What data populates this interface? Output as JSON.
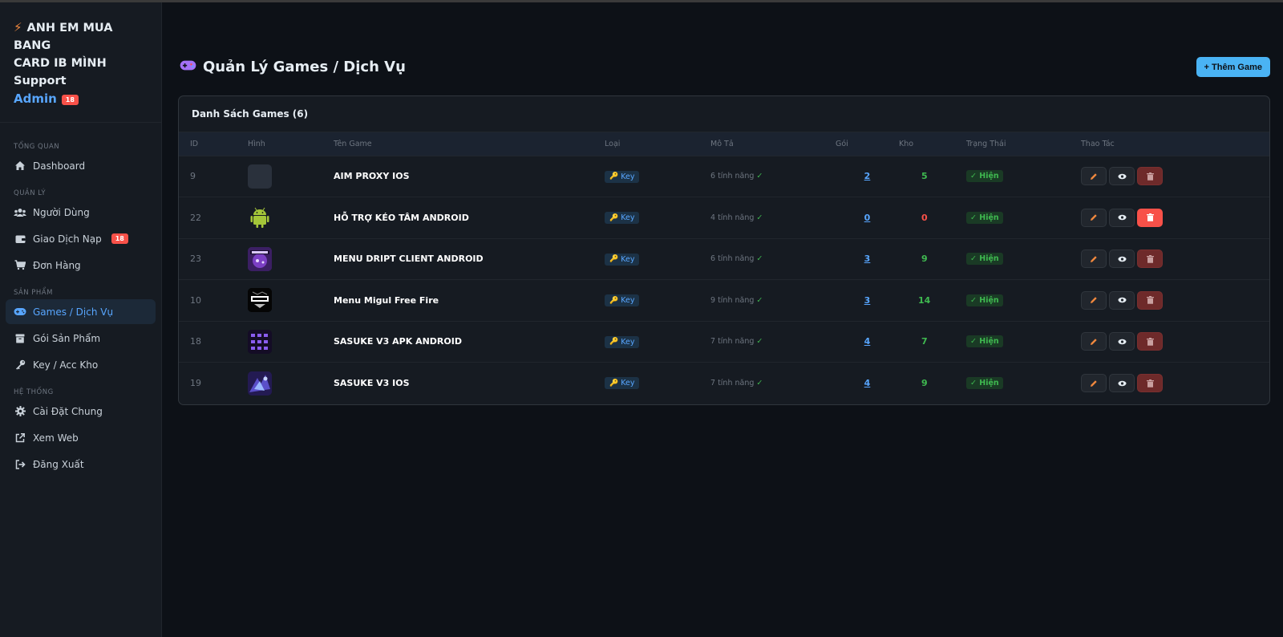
{
  "brand": {
    "line1": "ANH EM MUA BANG",
    "line2": "CARD IB MÌNH Support",
    "admin": "Admin",
    "badge": "18"
  },
  "sidebar": {
    "sections": [
      {
        "title": "TỔNG QUAN",
        "items": [
          {
            "label": "Dashboard",
            "icon": "home-icon"
          }
        ]
      },
      {
        "title": "QUẢN LÝ",
        "items": [
          {
            "label": "Người Dùng",
            "icon": "users-icon"
          },
          {
            "label": "Giao Dịch Nạp",
            "icon": "wallet-icon",
            "badge": "18"
          },
          {
            "label": "Đơn Hàng",
            "icon": "cart-icon"
          }
        ]
      },
      {
        "title": "SẢN PHẨM",
        "items": [
          {
            "label": "Games / Dịch Vụ",
            "icon": "gamepad-icon",
            "active": true
          },
          {
            "label": "Gói Sản Phẩm",
            "icon": "box-icon"
          },
          {
            "label": "Key / Acc Kho",
            "icon": "key-icon"
          }
        ]
      },
      {
        "title": "HỆ THỐNG",
        "items": [
          {
            "label": "Cài Đặt Chung",
            "icon": "gear-icon"
          },
          {
            "label": "Xem Web",
            "icon": "external-link-icon"
          },
          {
            "label": "Đăng Xuất",
            "icon": "logout-icon"
          }
        ]
      }
    ]
  },
  "page": {
    "title": "Quản Lý Games / Dịch Vụ",
    "add_button": "+ Thêm Game",
    "card_title": "Danh Sách Games (6)"
  },
  "table": {
    "headers": [
      "ID",
      "Hình",
      "Tên Game",
      "Loại",
      "Mô Tả",
      "Gói",
      "Kho",
      "Trạng Thái",
      "Thao Tác"
    ],
    "rows": [
      {
        "id": "9",
        "name": "AIM PROXY IOS",
        "type": "Key",
        "desc": "6 tính năng",
        "goi": "2",
        "kho": "5",
        "status": "✓ Hiện"
      },
      {
        "id": "22",
        "name": "HỖ TRỢ KÉO TÂM ANDROID",
        "type": "Key",
        "desc": "4 tính năng",
        "goi": "0",
        "kho": "0",
        "status": "✓ Hiện"
      },
      {
        "id": "23",
        "name": "MENU DRIPT CLIENT ANDROID",
        "type": "Key",
        "desc": "6 tính năng",
        "goi": "3",
        "kho": "9",
        "status": "✓ Hiện"
      },
      {
        "id": "10",
        "name": "Menu Migul Free Fire",
        "type": "Key",
        "desc": "9 tính năng",
        "goi": "3",
        "kho": "14",
        "status": "✓ Hiện"
      },
      {
        "id": "18",
        "name": "SASUKE V3 APK ANDROID",
        "type": "Key",
        "desc": "7 tính năng",
        "goi": "4",
        "kho": "7",
        "status": "✓ Hiện"
      },
      {
        "id": "19",
        "name": "SASUKE V3 IOS",
        "type": "Key",
        "desc": "7 tính năng",
        "goi": "4",
        "kho": "9",
        "status": "✓ Hiện"
      }
    ]
  },
  "colors": {
    "accent": "#4ab3f4",
    "success": "#3fb950",
    "danger": "#f85149"
  }
}
